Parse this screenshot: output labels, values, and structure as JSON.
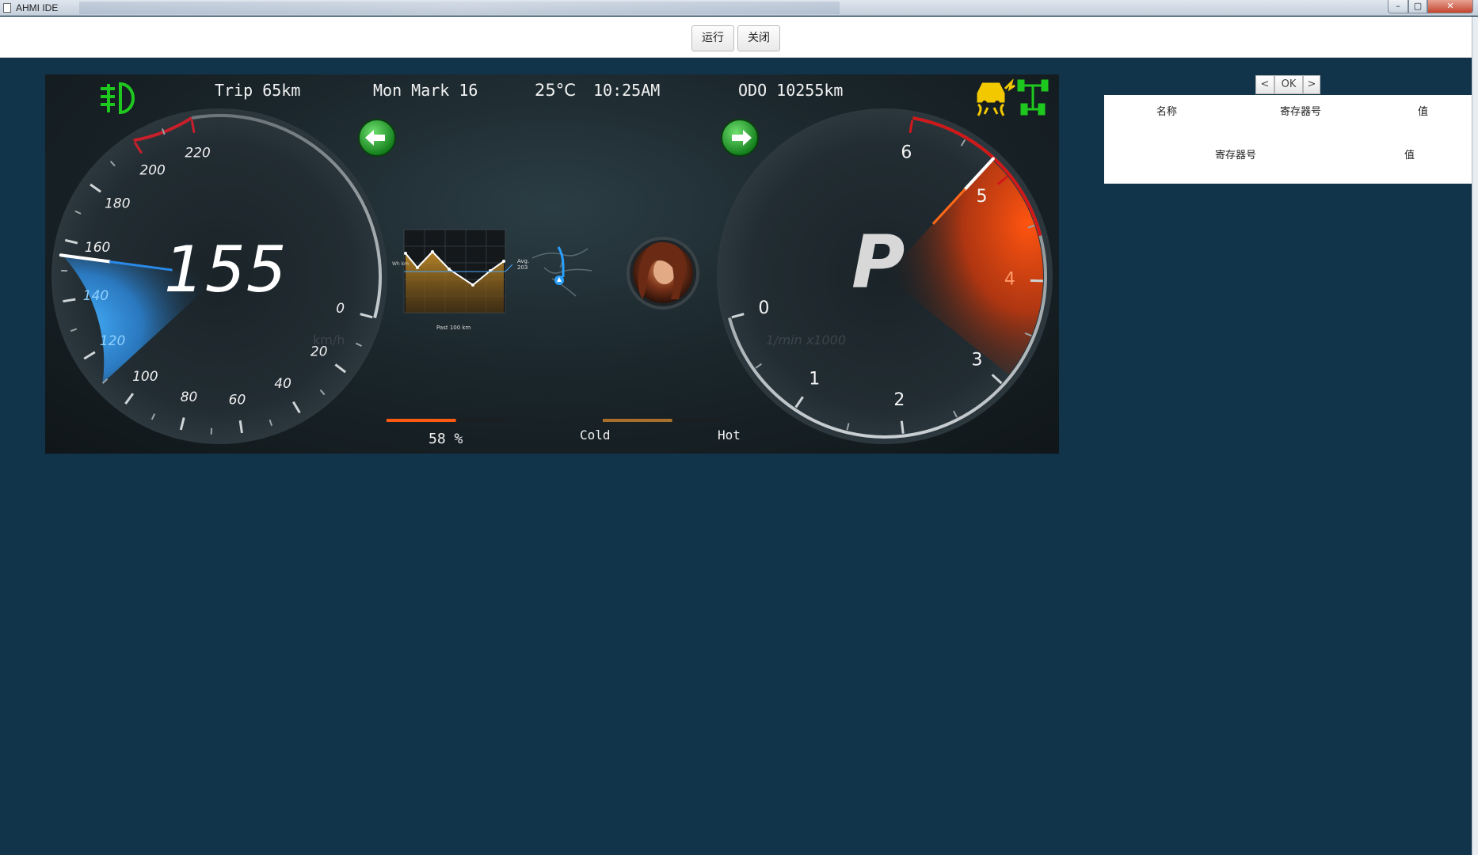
{
  "window": {
    "title": "AHMI IDE",
    "min": "–",
    "max": "▢",
    "close": "✕"
  },
  "toolbar": {
    "run_label": "运行",
    "close_label": "关闭"
  },
  "dashboard": {
    "trip": "Trip 65km",
    "date": "Mon Mark 16",
    "temperature": "25°C",
    "time": "10:25AM",
    "odo": "ODO 10255km",
    "speed": "155",
    "speed_unit": "km/h",
    "rpm_unit": "1/min x1000",
    "gear": "P",
    "battery": "58 %",
    "battery_level": 0.58,
    "coolant_level": 0.58,
    "cold_label": "Cold",
    "hot_label": "Hot",
    "chart_caption": "Past 100 km",
    "chart_ylabel": "Wh km",
    "avg_label": "Avg.",
    "avg_value": "203",
    "speedo_ticks": [
      "0",
      "20",
      "40",
      "60",
      "80",
      "100",
      "120",
      "140",
      "160",
      "180",
      "200",
      "220"
    ],
    "tacho_ticks": [
      "0",
      "1",
      "2",
      "3",
      "4",
      "5",
      "6"
    ],
    "speed_kmh": 155,
    "rpm_k": 5.2,
    "colors": {
      "speed": "#3aa8f0",
      "rpm": "#ff5a12",
      "redline": "#d01818",
      "green_icon": "#1ec81e",
      "amber_icon": "#f2c800",
      "arrow": "#2ea836"
    },
    "icons": [
      "fog-light-icon",
      "traction-control-icon",
      "awd-icon",
      "left-turn-signal-icon",
      "right-turn-signal-icon",
      "navigation-icon",
      "profile-avatar"
    ]
  },
  "registers": {
    "prev_label": "<",
    "ok_label": "OK",
    "next_label": ">",
    "headers": [
      "名称",
      "寄存器号",
      "值"
    ],
    "headers2": [
      "寄存器号",
      "值"
    ]
  }
}
